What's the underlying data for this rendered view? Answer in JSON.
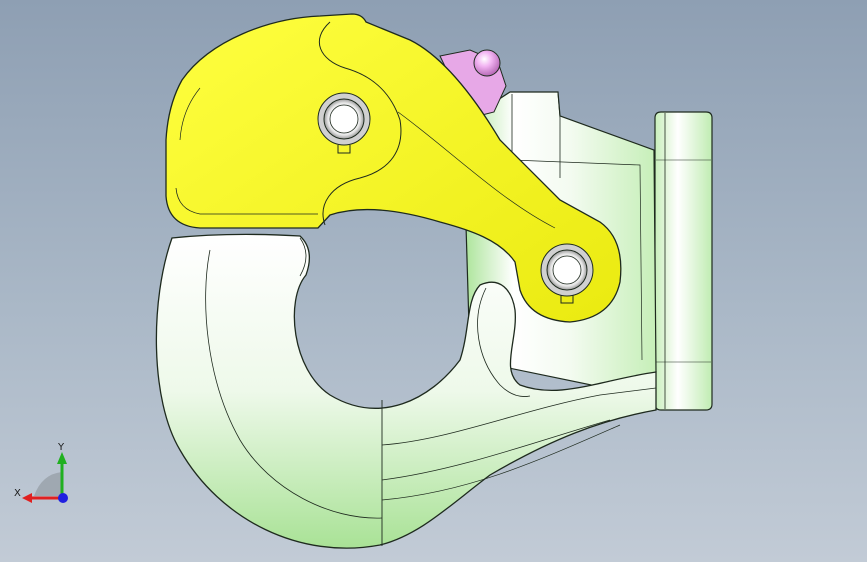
{
  "viewport": {
    "model": "hook-assembly",
    "parts": [
      "hook-body",
      "latch-arm",
      "spring-lever",
      "mounting-flange",
      "pivot-pin-upper",
      "pivot-pin-lower"
    ]
  },
  "colors": {
    "background_top": "#8e9fb3",
    "background_bottom": "#c2cbd6",
    "hook_body_light": "#f4fbf2",
    "hook_body_shade": "#b9eaa9",
    "latch_fill": "#ffff33",
    "latch_shade": "#e8e800",
    "lever_fill": "#e6a6e6",
    "lever_ball": "#f0b8f0",
    "edge": "#1e2a1e",
    "x_axis": "#e02020",
    "y_axis": "#20b020",
    "z_axis": "#2020e0"
  },
  "triad": {
    "x_label": "X",
    "y_label": "Y"
  }
}
